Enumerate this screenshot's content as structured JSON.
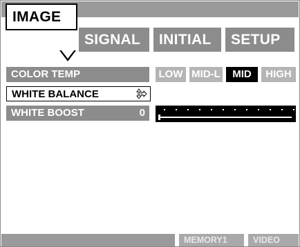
{
  "tabs": [
    {
      "label": "IMAGE",
      "active": true
    },
    {
      "label": "SIGNAL",
      "active": false
    },
    {
      "label": "INITIAL",
      "active": false
    },
    {
      "label": "SETUP",
      "active": false
    }
  ],
  "rows": {
    "color_temp": {
      "label": "COLOR TEMP"
    },
    "white_balance": {
      "label": "WHITE BALANCE",
      "icon": "up-down-right-arrow-icon"
    },
    "white_boost": {
      "label": "WHITE BOOST",
      "value": "0"
    }
  },
  "color_temp_options": [
    {
      "label": "LOW",
      "selected": false
    },
    {
      "label": "MID-L",
      "selected": false
    },
    {
      "label": "MID",
      "selected": true
    },
    {
      "label": "HIGH",
      "selected": false
    }
  ],
  "white_boost_slider": {
    "level": 0
  },
  "status": {
    "memory": "MEMORY1",
    "input": "VIDEO"
  },
  "colors": {
    "bar_gray": "#8c8c8c",
    "option_off": "#b5b5b5",
    "option_on": "#000000"
  }
}
